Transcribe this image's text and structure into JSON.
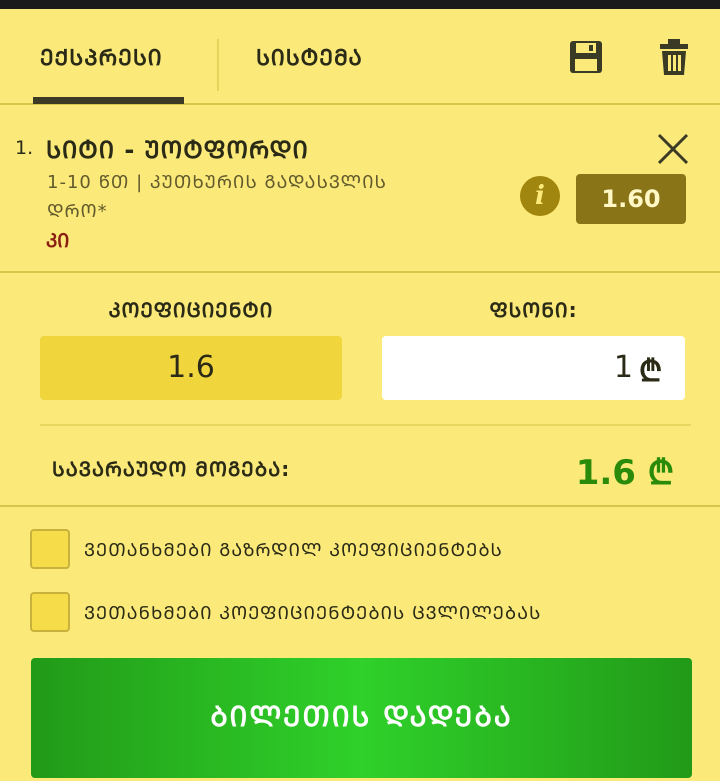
{
  "tabs": [
    {
      "label": "ᲔᲥᲡᲞᲠᲔᲡᲘ",
      "active": true
    },
    {
      "label": "ᲡᲘᲡᲢᲔᲛᲐ",
      "active": false
    }
  ],
  "toolbar": {
    "save_icon": "save-icon",
    "delete_icon": "trash-icon"
  },
  "selection": {
    "number": "1.",
    "title": "ᲡᲘᲢᲘ - ᲣᲝᲢᲤᲝᲠᲓᲘ",
    "market": "1-10 ᲬᲗ | ᲙᲣᲗᲮᲣᲠᲘᲡ ᲒᲐᲓᲐᲡᲕᲚᲘᲡ ᲓᲠᲝ*",
    "pick": "ᲙᲘ",
    "info_symbol": "i",
    "odds": "1.60"
  },
  "stake": {
    "coef_label": "ᲙᲝᲔᲤᲘᲪᲘᲔᲜᲢᲘ",
    "coef_value": "1.6",
    "stake_label": "ᲤᲡᲝᲜᲘ:",
    "stake_value": "1",
    "currency": "₾",
    "potential_label": "ᲡᲐᲕᲐᲠᲐᲣᲓᲝ ᲛᲝᲒᲔᲑᲐ:",
    "potential_value": "1.6 ₾"
  },
  "options": [
    {
      "label": "ᲕᲔᲗᲐᲜᲮᲛᲔᲑᲘ ᲒᲐᲖᲠᲓᲘᲚ ᲙᲝᲔᲤᲘᲪᲘᲔᲜᲢᲔᲑᲡ",
      "checked": false
    },
    {
      "label": "ᲕᲔᲗᲐᲜᲮᲛᲔᲑᲘ ᲙᲝᲔᲤᲘᲪᲘᲔᲜᲢᲔᲑᲘᲡ ᲪᲕᲚᲘᲚᲔᲑᲐᲡ",
      "checked": false
    }
  ],
  "place_bet_label": "ᲑᲘᲚᲔᲗᲘᲡ ᲓᲐᲓᲔᲑᲐ",
  "colors": {
    "background": "#fbea7a",
    "accent_dark": "#8a7418",
    "win_green": "#2a8a0a",
    "button_green": "#2fd12a",
    "pick_red": "#8b1e12"
  }
}
